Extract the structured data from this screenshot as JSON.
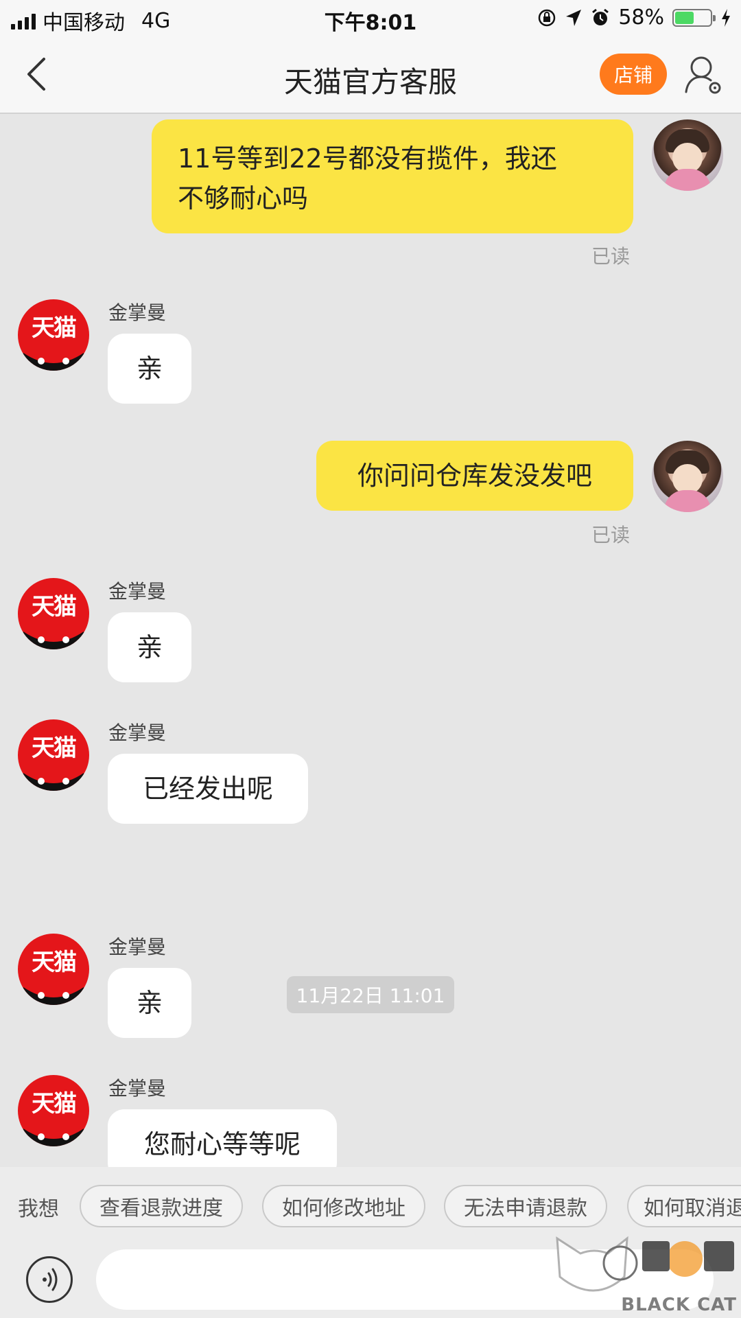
{
  "status_bar": {
    "carrier": "中国移动",
    "network": "4G",
    "time": "下午8:01",
    "battery": "58%",
    "battery_level": 0.58
  },
  "nav": {
    "title": "天猫官方客服",
    "shop_label": "店铺",
    "icons": {
      "back": "chevron-left-icon",
      "profile": "user-settings-icon"
    }
  },
  "messages": [
    {
      "side": "mine",
      "line1": "11号等到22号都没有揽件，我还",
      "line2": "不够耐心吗",
      "status": "已读"
    },
    {
      "side": "theirs",
      "sender": "金掌曼",
      "text": "亲"
    },
    {
      "side": "mine",
      "text": "你问问仓库发没发吧",
      "status": "已读"
    },
    {
      "side": "theirs",
      "sender": "金掌曼",
      "text": "亲"
    },
    {
      "side": "theirs",
      "sender": "金掌曼",
      "text": "已经发出呢"
    },
    {
      "side": "theirs",
      "sender": "金掌曼",
      "text": "亲"
    },
    {
      "side": "theirs",
      "sender": "金掌曼",
      "text": "您耐心等等呢"
    }
  ],
  "timestamp": "11月22日 11:01",
  "avatar_text": "天猫",
  "quick_replies": {
    "label": "我想",
    "chips": [
      "查看退款进度",
      "如何修改地址",
      "无法申请退款",
      "如何取消退"
    ]
  },
  "input": {
    "placeholder": "",
    "value": ""
  },
  "watermark": {
    "text": "BLACK CAT"
  },
  "colors": {
    "bubble_mine": "#fbe444",
    "bubble_theirs": "#ffffff",
    "shop_button": "#ff7a1c",
    "brand_red": "#e4161a"
  }
}
